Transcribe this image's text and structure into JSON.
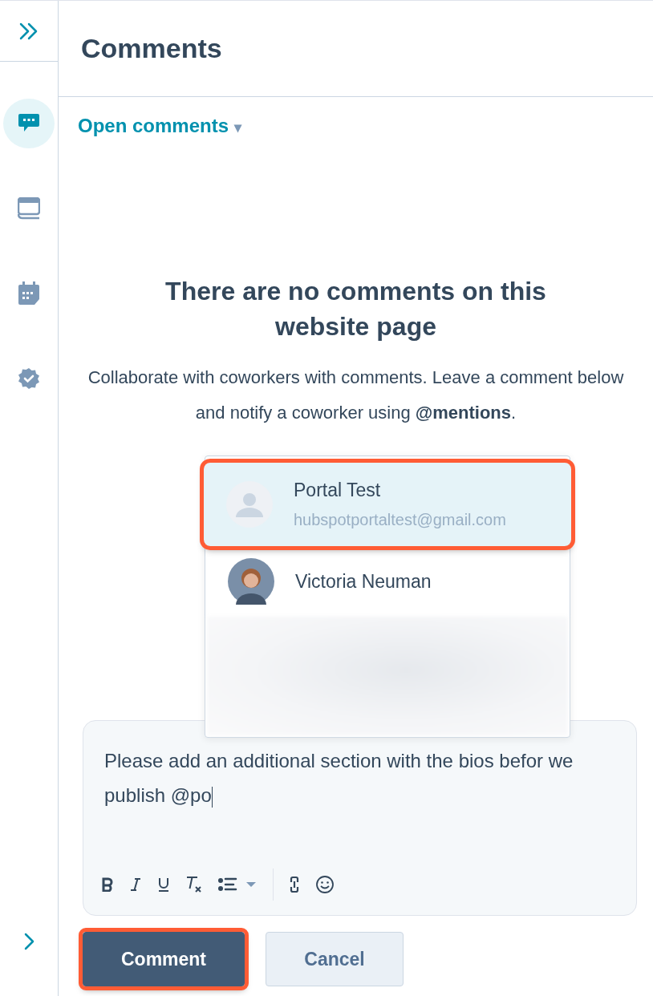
{
  "panel": {
    "title": "Comments"
  },
  "sidebar": {
    "items": [
      {
        "kind": "comments",
        "selected": true
      },
      {
        "kind": "page",
        "selected": false
      },
      {
        "kind": "calendar",
        "selected": false
      },
      {
        "kind": "badge",
        "selected": false
      }
    ]
  },
  "filter": {
    "label": "Open comments",
    "caret": "▾"
  },
  "empty_state": {
    "heading": "There are no comments on this website page",
    "text": "Collaborate with coworkers with comments. Leave a comment below and notify a coworker using **@mentions**."
  },
  "mention_menu": {
    "users": [
      {
        "name": "Portal Test",
        "email": "hubspotportaltest@gmail.com",
        "kind": "placeholder",
        "selected": true,
        "highlighted": true
      },
      {
        "name": "Victoria Neuman",
        "kind": "photo",
        "selected": false,
        "highlighted": false
      }
    ],
    "blurred": true
  },
  "editor": {
    "value": "Please add an additional section with the bios befor we publish @po"
  },
  "buttons": [
    {
      "label": "Comment",
      "kind": "primary",
      "highlighted": true
    },
    {
      "label": "Cancel",
      "kind": "secondary",
      "highlighted": false
    }
  ]
}
